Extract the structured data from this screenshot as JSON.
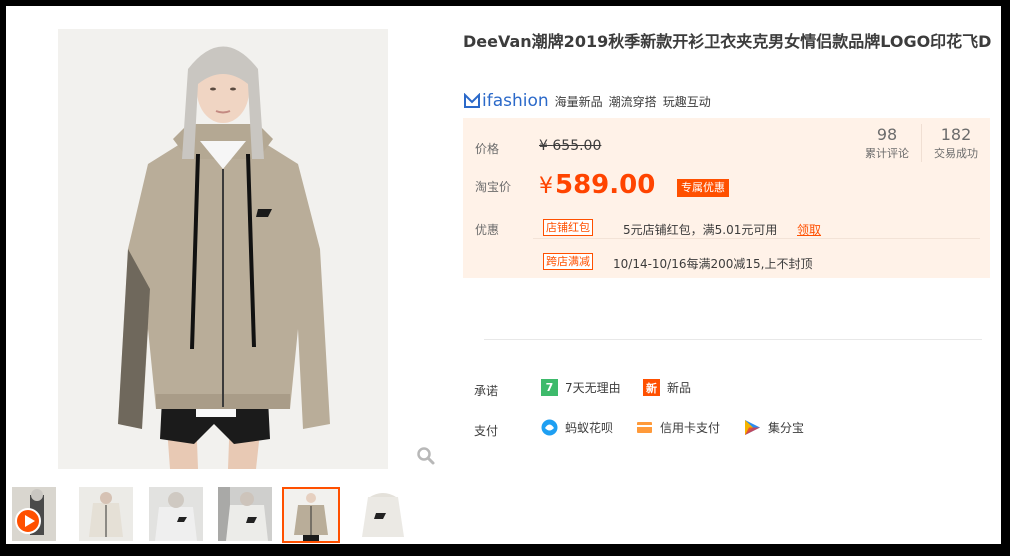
{
  "product": {
    "title": "DeeVan潮牌2019秋季新款开衫卫衣夹克男女情侣款品牌LOGO印花飞D"
  },
  "brand": {
    "logo_text": "ifashion",
    "tags": [
      "海量新品",
      "潮流穿搭",
      "玩趣互动"
    ]
  },
  "price": {
    "label_price": "价格",
    "original": "655.00",
    "label_taobao": "淘宝价",
    "current": "589.00",
    "currency": "¥",
    "special_tag": "专属优惠",
    "accent_color": "#ff4400"
  },
  "stats": [
    {
      "value": "98",
      "label": "累计评论"
    },
    {
      "value": "182",
      "label": "交易成功"
    }
  ],
  "promotions": {
    "label": "优惠",
    "items": [
      {
        "tag": "店铺红包",
        "text": "5元店铺红包，满5.01元可用",
        "link": "领取"
      },
      {
        "tag": "跨店满减",
        "text": "10/14-10/16每满200减15,上不封顶"
      }
    ]
  },
  "commitment": {
    "label": "承诺",
    "items": [
      {
        "icon": "seven-day-return-icon",
        "icon_text": "7",
        "text": "7天无理由"
      },
      {
        "icon": "new-product-icon",
        "icon_text": "新",
        "text": "新品"
      }
    ]
  },
  "payment": {
    "label": "支付",
    "items": [
      {
        "icon": "ant-huabei-icon",
        "text": "蚂蚁花呗"
      },
      {
        "icon": "credit-card-icon",
        "text": "信用卡支付"
      },
      {
        "icon": "jifenbao-icon",
        "text": "集分宝"
      }
    ]
  },
  "gallery": {
    "thumb_count": 6,
    "active_index": 4
  }
}
